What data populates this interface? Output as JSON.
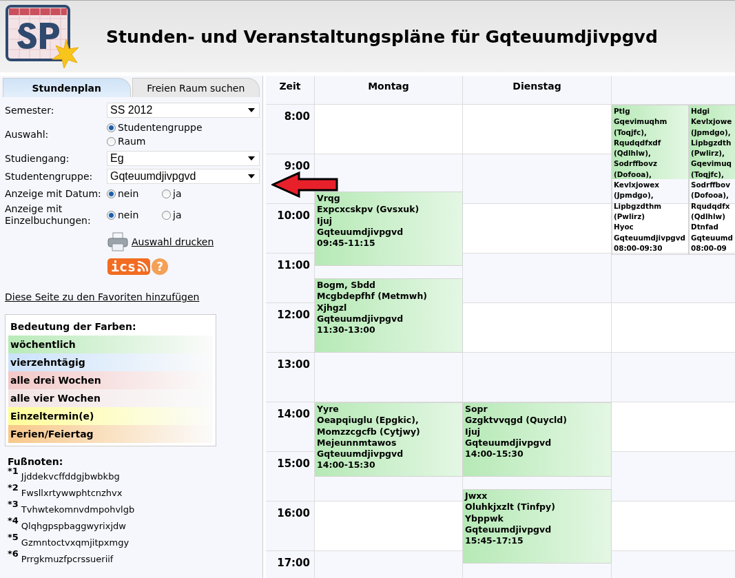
{
  "header": {
    "title": "Stunden- und Veranstaltungspläne für Gqteuumdjivpgvd"
  },
  "tabs": [
    {
      "label": "Stundenplan",
      "selected": true
    },
    {
      "label": "Freien Raum suchen",
      "selected": false
    }
  ],
  "form": [
    {
      "kind": "select",
      "label": "Semester:",
      "value": "SS 2012"
    },
    {
      "kind": "radiolist",
      "label": "Auswahl:",
      "options": [
        {
          "label": "Studentengruppe",
          "selected": true
        },
        {
          "label": "Raum",
          "selected": false
        }
      ]
    },
    {
      "kind": "select",
      "label": "Studiengang:",
      "value": "Eg"
    },
    {
      "kind": "select",
      "label": "Studentengruppe:",
      "value": "Gqteuumdjivpgvd"
    },
    {
      "kind": "radio",
      "label": "Anzeige mit Datum:",
      "options": [
        {
          "label": "nein",
          "selected": true
        },
        {
          "label": "ja",
          "selected": false
        }
      ]
    },
    {
      "kind": "radio",
      "label": "Anzeige mit Einzelbuchungen:",
      "options": [
        {
          "label": "nein",
          "selected": true
        },
        {
          "label": "ja",
          "selected": false
        }
      ]
    }
  ],
  "print_link": "Auswahl drucken",
  "ics_badge": "ics",
  "help_badge": "?",
  "favorites_link": "Diese Seite zu den Favoriten hinzufügen",
  "legend": {
    "title": "Bedeutung der Farben:",
    "items": [
      {
        "label": "wöchentlich",
        "color": "#b8eab8"
      },
      {
        "label": "vierzehntägig",
        "color": "#cbe2fb"
      },
      {
        "label": "alle drei Wochen",
        "color": "#f3c8c8"
      },
      {
        "label": "alle vier Wochen",
        "color": "#f3e4e4"
      },
      {
        "label": "Einzeltermin(e)",
        "color": "#ffff99"
      },
      {
        "label": "Ferien/Feiertag",
        "color": "#f8c88a"
      }
    ]
  },
  "footnotes": {
    "title": "Fußnoten:",
    "items": [
      {
        "mark": "*1",
        "text": "Jjddekvcffddgjbwbkbg"
      },
      {
        "mark": "*2",
        "text": "Fwsllxrtywwphtcnzhvx"
      },
      {
        "mark": "*3",
        "text": "Tvhwtekomnvdmpohvlgb"
      },
      {
        "mark": "*4",
        "text": "Qlqhgpspbaggwyrixjdw"
      },
      {
        "mark": "*5",
        "text": "Gzmntoctvxqmjitpxmgy"
      },
      {
        "mark": "*6",
        "text": "Prrgkmuzfpcrssueriif"
      }
    ]
  },
  "timetable": {
    "time_header": "Zeit",
    "hours": [
      "8:00",
      "9:00",
      "10:00",
      "11:00",
      "12:00",
      "13:00",
      "14:00",
      "15:00",
      "16:00",
      "17:00"
    ],
    "days": [
      {
        "label": "Montag",
        "lanes": [
          {
            "events": [
              {
                "lines": [
                  "Vrqg",
                  "Expcxcskpv (Gvsxuk)",
                  "Ijuj",
                  "Gqteuumdjivpgvd"
                ],
                "time": "09:45-11:15"
              },
              {
                "lines": [
                  "Bogm, Sbdd",
                  "Mcgbdepfhf (Metmwh)",
                  "Xjhgzl",
                  "Gqteuumdjivpgvd"
                ],
                "time": "11:30-13:00"
              },
              {
                "lines": [
                  "Yyre",
                  "Oeapqiuglu (Epgkic), Momzzcgcfb (Cytjwy)",
                  "Mejeunnmtawos",
                  "Gqteuumdjivpgvd"
                ],
                "time": "14:00-15:30"
              }
            ]
          }
        ]
      },
      {
        "label": "Dienstag",
        "lanes": [
          {
            "events": [
              {
                "lines": [
                  "Sopr",
                  "Gzgktvvqgd (Quycld)",
                  "Ijuj",
                  "Gqteuumdjivpgvd"
                ],
                "time": "14:00-15:30"
              },
              {
                "lines": [
                  "Jwxx",
                  "Oluhkjxzlt (Tinfpy)",
                  "Ybppwk",
                  "Gqteuumdjivpgvd"
                ],
                "time": "15:45-17:15"
              }
            ]
          }
        ]
      },
      {
        "lanes": [
          {
            "events": [
              {
                "lines": [
                  "Ptlg",
                  "Gqevimuqhm (Toqjfc), Rqudqdfxdf (Qdlhlw), Sodrffbovz (Dofooa), Kevlxjowex (Jpmdgo), Lipbgzdthm (Pwlirz)",
                  "Hyoc",
                  "Gqteuumdjivpgvd"
                ],
                "time": "08:00-09:30"
              }
            ]
          },
          {
            "events": [
              {
                "lines": [
                  "Hdgi",
                  "Kevlxjowe",
                  "(Jpmdgo),",
                  "Lipbgzdth",
                  "(Pwlirz),",
                  "Gqevimuq",
                  "(Toqjfc),",
                  "Sodrffbov",
                  "(Dofooa),",
                  "Rqudqdfx",
                  "(Qdlhlw)",
                  "Dtnfad",
                  "Gqteuumd"
                ],
                "time": "08:00-09"
              }
            ]
          }
        ]
      }
    ]
  }
}
